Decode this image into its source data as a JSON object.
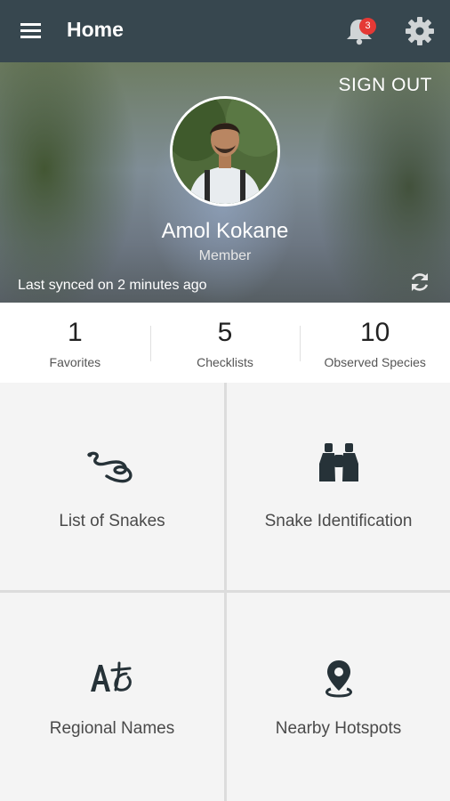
{
  "appbar": {
    "title": "Home",
    "notification_count": "3",
    "icons": [
      "menu-icon",
      "bell-icon",
      "gear-icon"
    ],
    "background": "#37474f"
  },
  "profile": {
    "sign_out_label": "SIGN OUT",
    "name": "Amol Kokane",
    "role": "Member",
    "last_synced": "Last synced on 2 minutes ago"
  },
  "stats": [
    {
      "value": "1",
      "label": "Favorites"
    },
    {
      "value": "5",
      "label": "Checklists"
    },
    {
      "value": "10",
      "label": "Observed Species"
    }
  ],
  "tiles": [
    {
      "label": "List of Snakes",
      "icon": "snake-icon"
    },
    {
      "label": "Snake Identification",
      "icon": "binoculars-icon"
    },
    {
      "label": "Regional Names",
      "icon": "translate-icon"
    },
    {
      "label": "Nearby Hotspots",
      "icon": "location-pin-icon"
    }
  ],
  "colors": {
    "badge": "#e53935",
    "tile_background": "#f4f4f4",
    "icon_dark": "#263238"
  }
}
